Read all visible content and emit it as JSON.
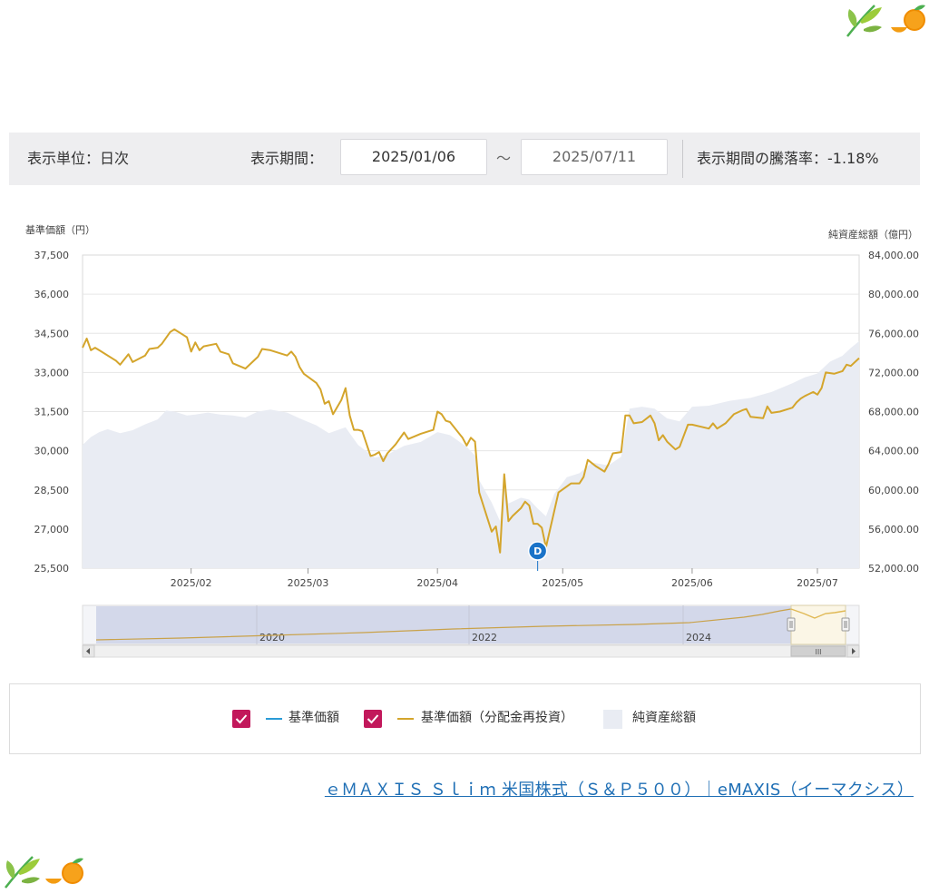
{
  "controls": {
    "unit_label": "表示単位：日次",
    "period_label": "表示期間：",
    "start_date": "2025/01/06",
    "tilde": "～",
    "end_date": "2025/07/11",
    "change_label": "表示期間の騰落率：-1.18%"
  },
  "legend": {
    "item1": "基準価額",
    "item2": "基準価額（分配金再投資）",
    "item3": "純資産総額",
    "item1_checked": true,
    "item2_checked": true,
    "colors": {
      "check": "#c2185b",
      "nav": "#2a9bd6",
      "reinvest": "#d4a52c",
      "assets": "#e9ecf3"
    }
  },
  "link": {
    "text": "ｅＭＡＸＩＳ Ｓｌｉｍ 米国株式（Ｓ＆Ｐ５００）｜eMAXIS（イーマクシス）"
  },
  "marker": {
    "label": "D",
    "date": "2025/04/25",
    "color": "#1a73c8"
  },
  "navigator": {
    "labels": [
      "2020",
      "2022",
      "2024"
    ],
    "scroll_grip": "III"
  },
  "decorations": [
    "leaf-orange-icon"
  ],
  "chart_data": {
    "type": "line",
    "y_left": {
      "title": "基準価額（円）",
      "range": [
        25500,
        37500
      ],
      "ticks": [
        "37,500",
        "36,000",
        "34,500",
        "33,000",
        "31,500",
        "30,000",
        "28,500",
        "27,000",
        "25,500"
      ]
    },
    "y_right": {
      "title": "純資産総額（億円）",
      "range": [
        52000,
        84000
      ],
      "ticks": [
        "84,000.00",
        "80,000.00",
        "76,000.00",
        "72,000.00",
        "68,000.00",
        "64,000.00",
        "60,000.00",
        "56,000.00",
        "52,000.00"
      ]
    },
    "x_range": [
      "2025-01-06",
      "2025-07-11"
    ],
    "x_ticks": [
      {
        "date": "2025-02-01",
        "label": "2025/02"
      },
      {
        "date": "2025-03-01",
        "label": "2025/03"
      },
      {
        "date": "2025-04-01",
        "label": "2025/04"
      },
      {
        "date": "2025-05-01",
        "label": "2025/05"
      },
      {
        "date": "2025-06-01",
        "label": "2025/06"
      },
      {
        "date": "2025-07-01",
        "label": "2025/07"
      }
    ],
    "grid": true,
    "series": [
      {
        "name": "基準価額（分配金再投資）",
        "axis": "left",
        "points": [
          [
            "2025-01-06",
            33950
          ],
          [
            "2025-01-07",
            34300
          ],
          [
            "2025-01-08",
            33850
          ],
          [
            "2025-01-09",
            33950
          ],
          [
            "2025-01-10",
            33850
          ],
          [
            "2025-01-14",
            33450
          ],
          [
            "2025-01-15",
            33300
          ],
          [
            "2025-01-17",
            33700
          ],
          [
            "2025-01-18",
            33400
          ],
          [
            "2025-01-21",
            33650
          ],
          [
            "2025-01-22",
            33900
          ],
          [
            "2025-01-24",
            33950
          ],
          [
            "2025-01-25",
            34100
          ],
          [
            "2025-01-27",
            34550
          ],
          [
            "2025-01-28",
            34650
          ],
          [
            "2025-01-30",
            34450
          ],
          [
            "2025-01-31",
            34350
          ],
          [
            "2025-02-01",
            33800
          ],
          [
            "2025-02-02",
            34150
          ],
          [
            "2025-02-03",
            33850
          ],
          [
            "2025-02-04",
            34000
          ],
          [
            "2025-02-07",
            34100
          ],
          [
            "2025-02-08",
            33800
          ],
          [
            "2025-02-10",
            33700
          ],
          [
            "2025-02-11",
            33350
          ],
          [
            "2025-02-14",
            33150
          ],
          [
            "2025-02-17",
            33600
          ],
          [
            "2025-02-18",
            33900
          ],
          [
            "2025-02-20",
            33850
          ],
          [
            "2025-02-24",
            33650
          ],
          [
            "2025-02-25",
            33800
          ],
          [
            "2025-02-26",
            33600
          ],
          [
            "2025-02-27",
            33200
          ],
          [
            "2025-02-28",
            32950
          ],
          [
            "2025-03-03",
            32600
          ],
          [
            "2025-03-04",
            32350
          ],
          [
            "2025-03-05",
            31800
          ],
          [
            "2025-03-06",
            31900
          ],
          [
            "2025-03-07",
            31400
          ],
          [
            "2025-03-09",
            31950
          ],
          [
            "2025-03-10",
            32400
          ],
          [
            "2025-03-11",
            31350
          ],
          [
            "2025-03-12",
            30800
          ],
          [
            "2025-03-13",
            30800
          ],
          [
            "2025-03-14",
            30750
          ],
          [
            "2025-03-16",
            29800
          ],
          [
            "2025-03-17",
            29850
          ],
          [
            "2025-03-18",
            29950
          ],
          [
            "2025-03-19",
            29600
          ],
          [
            "2025-03-20",
            29900
          ],
          [
            "2025-03-22",
            30250
          ],
          [
            "2025-03-24",
            30700
          ],
          [
            "2025-03-25",
            30450
          ],
          [
            "2025-03-28",
            30650
          ],
          [
            "2025-03-31",
            30800
          ],
          [
            "2025-04-01",
            31500
          ],
          [
            "2025-04-02",
            31400
          ],
          [
            "2025-04-03",
            31150
          ],
          [
            "2025-04-04",
            31100
          ],
          [
            "2025-04-07",
            30500
          ],
          [
            "2025-04-08",
            30200
          ],
          [
            "2025-04-09",
            30500
          ],
          [
            "2025-04-10",
            30350
          ],
          [
            "2025-04-11",
            28400
          ],
          [
            "2025-04-12",
            27900
          ],
          [
            "2025-04-13",
            27400
          ],
          [
            "2025-04-14",
            26900
          ],
          [
            "2025-04-15",
            27100
          ],
          [
            "2025-04-16",
            26100
          ],
          [
            "2025-04-17",
            29100
          ],
          [
            "2025-04-18",
            27300
          ],
          [
            "2025-04-19",
            27500
          ],
          [
            "2025-04-21",
            27800
          ],
          [
            "2025-04-22",
            28050
          ],
          [
            "2025-04-23",
            27900
          ],
          [
            "2025-04-24",
            27200
          ],
          [
            "2025-04-25",
            27200
          ],
          [
            "2025-04-26",
            27050
          ],
          [
            "2025-04-27",
            26300
          ],
          [
            "2025-04-28",
            27000
          ],
          [
            "2025-04-29",
            27700
          ],
          [
            "2025-04-30",
            28400
          ],
          [
            "2025-05-03",
            28750
          ],
          [
            "2025-05-05",
            28750
          ],
          [
            "2025-05-06",
            29000
          ],
          [
            "2025-05-07",
            29650
          ],
          [
            "2025-05-09",
            29400
          ],
          [
            "2025-05-11",
            29200
          ],
          [
            "2025-05-12",
            29500
          ],
          [
            "2025-05-13",
            29900
          ],
          [
            "2025-05-15",
            29950
          ],
          [
            "2025-05-16",
            31350
          ],
          [
            "2025-05-17",
            31350
          ],
          [
            "2025-05-18",
            31050
          ],
          [
            "2025-05-20",
            31100
          ],
          [
            "2025-05-22",
            31350
          ],
          [
            "2025-05-23",
            31050
          ],
          [
            "2025-05-24",
            30400
          ],
          [
            "2025-05-25",
            30600
          ],
          [
            "2025-05-26",
            30350
          ],
          [
            "2025-05-28",
            30050
          ],
          [
            "2025-05-29",
            30150
          ],
          [
            "2025-05-31",
            31000
          ],
          [
            "2025-06-01",
            31000
          ],
          [
            "2025-06-05",
            30850
          ],
          [
            "2025-06-06",
            31050
          ],
          [
            "2025-06-07",
            30850
          ],
          [
            "2025-06-09",
            31050
          ],
          [
            "2025-06-11",
            31400
          ],
          [
            "2025-06-13",
            31550
          ],
          [
            "2025-06-14",
            31600
          ],
          [
            "2025-06-15",
            31300
          ],
          [
            "2025-06-18",
            31250
          ],
          [
            "2025-06-19",
            31700
          ],
          [
            "2025-06-20",
            31450
          ],
          [
            "2025-06-22",
            31500
          ],
          [
            "2025-06-25",
            31650
          ],
          [
            "2025-06-26",
            31850
          ],
          [
            "2025-06-27",
            32000
          ],
          [
            "2025-06-28",
            32100
          ],
          [
            "2025-06-30",
            32250
          ],
          [
            "2025-07-01",
            32150
          ],
          [
            "2025-07-02",
            32400
          ],
          [
            "2025-07-03",
            33000
          ],
          [
            "2025-07-05",
            32950
          ],
          [
            "2025-07-07",
            33050
          ],
          [
            "2025-07-08",
            33300
          ],
          [
            "2025-07-09",
            33250
          ],
          [
            "2025-07-10",
            33400
          ],
          [
            "2025-07-11",
            33550
          ]
        ]
      },
      {
        "name": "純資産総額",
        "axis": "right",
        "points": [
          [
            "2025-01-06",
            64600
          ],
          [
            "2025-01-08",
            65400
          ],
          [
            "2025-01-10",
            65900
          ],
          [
            "2025-01-12",
            66200
          ],
          [
            "2025-01-15",
            65800
          ],
          [
            "2025-01-18",
            66100
          ],
          [
            "2025-01-21",
            66700
          ],
          [
            "2025-01-24",
            67200
          ],
          [
            "2025-01-26",
            68100
          ],
          [
            "2025-01-28",
            68000
          ],
          [
            "2025-01-31",
            67600
          ],
          [
            "2025-02-02",
            67700
          ],
          [
            "2025-02-05",
            67900
          ],
          [
            "2025-02-08",
            67700
          ],
          [
            "2025-02-11",
            67600
          ],
          [
            "2025-02-14",
            67400
          ],
          [
            "2025-02-17",
            68000
          ],
          [
            "2025-02-20",
            68200
          ],
          [
            "2025-02-24",
            67900
          ],
          [
            "2025-02-27",
            67300
          ],
          [
            "2025-03-03",
            66600
          ],
          [
            "2025-03-06",
            65800
          ],
          [
            "2025-03-10",
            66400
          ],
          [
            "2025-03-13",
            64600
          ],
          [
            "2025-03-17",
            63300
          ],
          [
            "2025-03-20",
            63600
          ],
          [
            "2025-03-24",
            64500
          ],
          [
            "2025-03-28",
            64900
          ],
          [
            "2025-04-01",
            65900
          ],
          [
            "2025-04-04",
            65600
          ],
          [
            "2025-04-08",
            64400
          ],
          [
            "2025-04-10",
            63500
          ],
          [
            "2025-04-11",
            61000
          ],
          [
            "2025-04-14",
            58700
          ],
          [
            "2025-04-16",
            56800
          ],
          [
            "2025-04-17",
            61200
          ],
          [
            "2025-04-18",
            58600
          ],
          [
            "2025-04-21",
            59200
          ],
          [
            "2025-04-23",
            59000
          ],
          [
            "2025-04-25",
            58100
          ],
          [
            "2025-04-27",
            57300
          ],
          [
            "2025-04-29",
            59600
          ],
          [
            "2025-05-02",
            61300
          ],
          [
            "2025-05-05",
            61700
          ],
          [
            "2025-05-08",
            62800
          ],
          [
            "2025-05-12",
            62500
          ],
          [
            "2025-05-15",
            63400
          ],
          [
            "2025-05-17",
            68300
          ],
          [
            "2025-05-20",
            68500
          ],
          [
            "2025-05-23",
            68300
          ],
          [
            "2025-05-26",
            67300
          ],
          [
            "2025-05-29",
            67000
          ],
          [
            "2025-06-01",
            68500
          ],
          [
            "2025-06-05",
            68600
          ],
          [
            "2025-06-10",
            69100
          ],
          [
            "2025-06-15",
            69400
          ],
          [
            "2025-06-20",
            70000
          ],
          [
            "2025-06-25",
            70900
          ],
          [
            "2025-06-28",
            71500
          ],
          [
            "2025-07-01",
            71900
          ],
          [
            "2025-07-04",
            73100
          ],
          [
            "2025-07-07",
            73700
          ],
          [
            "2025-07-09",
            74500
          ],
          [
            "2025-07-11",
            75200
          ]
        ]
      }
    ]
  }
}
